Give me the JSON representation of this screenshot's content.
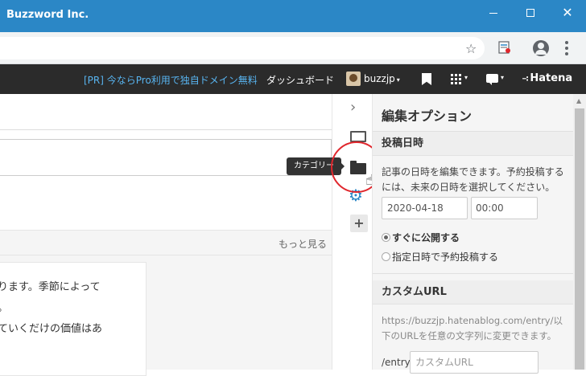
{
  "window": {
    "title": "Buzzword Inc.",
    "minimize_glyph": "",
    "close_glyph": "✕"
  },
  "browser": {
    "star_glyph": "☆"
  },
  "hatena_nav": {
    "pr_link": "[PR] 今ならPro利用で独自ドメイン無料",
    "dashboard": "ダッシュボード",
    "username": "buzzjp",
    "caret": "▾",
    "logo_mark": "∹",
    "logo": "Hatena"
  },
  "main": {
    "more_link": "もっと見る",
    "article_lines": [
      "ります。季節によって",
      "。",
      "ていくだけの価値はあ"
    ]
  },
  "icon_strip": {
    "chevron": "›",
    "gear": "⚙",
    "plus": "+",
    "tooltip": "カテゴリー",
    "cursor": "☝"
  },
  "panel": {
    "title": "編集オプション",
    "post_date": {
      "heading": "投稿日時",
      "description": "記事の日時を編集できます。予約投稿するには、未来の日時を選択してください。",
      "date_value": "2020-04-18",
      "time_value": "00:00",
      "option_now": "すぐに公開する",
      "option_scheduled": "指定日時で予約投稿する"
    },
    "custom_url": {
      "heading": "カスタムURL",
      "description": "https://buzzjp.hatenablog.com/entry/以下のURLを任意の文字列に変更できます。",
      "prefix": "/entry/",
      "placeholder": "カスタムURL"
    }
  },
  "scrollbar": {
    "arrow": "▲"
  }
}
